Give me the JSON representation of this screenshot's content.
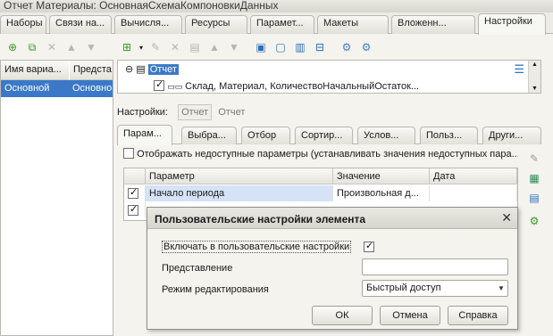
{
  "window": {
    "title": "Отчет Материалы: ОсновнаяСхемаКомпоновкиДанных"
  },
  "tabs": [
    {
      "label": "Наборы ..."
    },
    {
      "label": "Связи на..."
    },
    {
      "label": "Вычисля..."
    },
    {
      "label": "Ресурсы"
    },
    {
      "label": "Парамет..."
    },
    {
      "label": "Макеты"
    },
    {
      "label": "Вложенн..."
    },
    {
      "label": "Настройки"
    }
  ],
  "variants": {
    "columns": [
      "Имя вариа...",
      "Предста"
    ],
    "row": [
      "Основной",
      "Основно"
    ]
  },
  "structure": {
    "root_label": "Отчет",
    "child_label": "Склад, Материал, КоличествоНачальныйОстаток..."
  },
  "settings_bar": {
    "label": "Настройки:",
    "button": "Отчет",
    "link": "Отчет"
  },
  "subtabs": [
    {
      "label": "Парам..."
    },
    {
      "label": "Выбра..."
    },
    {
      "label": "Отбор"
    },
    {
      "label": "Сортир..."
    },
    {
      "label": "Услов..."
    },
    {
      "label": "Польз..."
    },
    {
      "label": "Други..."
    }
  ],
  "show_unavailable": {
    "label": "Отображать недоступные параметры (устанавливать значения недоступных пара..."
  },
  "params_grid": {
    "columns": [
      "Параметр",
      "Значение",
      "Дата"
    ],
    "rows": [
      {
        "checked": true,
        "param": "Начало периода",
        "value": "Произвольная д...",
        "date": ""
      },
      {
        "checked": true,
        "param": "",
        "value": "",
        "date": ""
      }
    ]
  },
  "dialog": {
    "title": "Пользовательские настройки элемента",
    "include_label": "Включать в пользовательские настройки",
    "include_checked": true,
    "repr_label": "Представление",
    "repr_value": "",
    "mode_label": "Режим редактирования",
    "mode_value": "Быстрый доступ",
    "ok": "ОК",
    "cancel": "Отмена",
    "help": "Справка"
  },
  "colors": {
    "selection": "#3b79c8",
    "row_highlight": "#d6e3f6",
    "background": "#f4f3ee"
  }
}
